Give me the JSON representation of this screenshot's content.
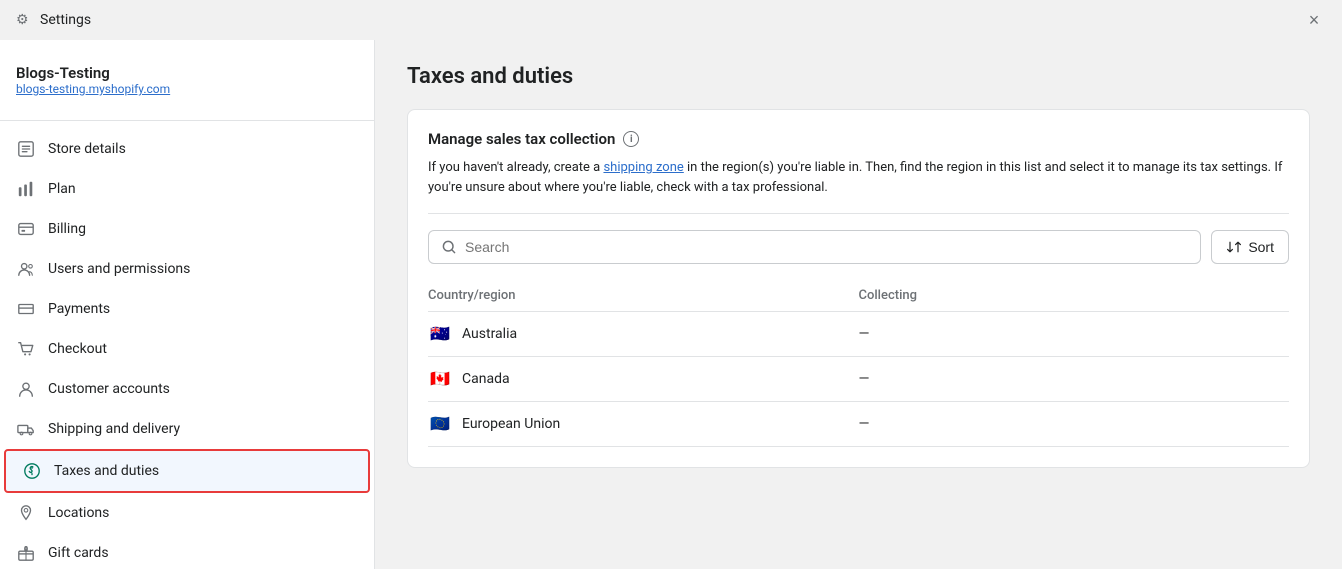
{
  "titleBar": {
    "icon": "⚙",
    "title": "Settings",
    "closeLabel": "×"
  },
  "sidebar": {
    "storeName": "Blogs-Testing",
    "storeUrl": "blogs-testing.myshopify.com",
    "items": [
      {
        "id": "store-details",
        "label": "Store details",
        "icon": "🏪"
      },
      {
        "id": "plan",
        "label": "Plan",
        "icon": "📊"
      },
      {
        "id": "billing",
        "label": "Billing",
        "icon": "🧾"
      },
      {
        "id": "users-permissions",
        "label": "Users and permissions",
        "icon": "👥"
      },
      {
        "id": "payments",
        "label": "Payments",
        "icon": "💳"
      },
      {
        "id": "checkout",
        "label": "Checkout",
        "icon": "🛒"
      },
      {
        "id": "customer-accounts",
        "label": "Customer accounts",
        "icon": "👤"
      },
      {
        "id": "shipping-delivery",
        "label": "Shipping and delivery",
        "icon": "🚚"
      },
      {
        "id": "taxes-duties",
        "label": "Taxes and duties",
        "icon": "🏷",
        "active": true
      },
      {
        "id": "locations",
        "label": "Locations",
        "icon": "📍"
      },
      {
        "id": "gift-cards",
        "label": "Gift cards",
        "icon": "🎁"
      }
    ]
  },
  "main": {
    "pageTitle": "Taxes and duties",
    "card": {
      "sectionTitle": "Manage sales tax collection",
      "description1": "If you haven't already, create a ",
      "linkText": "shipping zone",
      "description2": " in the region(s) you're liable in. Then, find the region in this list and select it to manage its tax settings. If you're unsure about where you're liable, check with a tax professional.",
      "searchPlaceholder": "Search",
      "sortLabel": "Sort",
      "tableHeaders": {
        "country": "Country/region",
        "collecting": "Collecting"
      },
      "rows": [
        {
          "country": "Australia",
          "flag": "🇦🇺",
          "collecting": "—"
        },
        {
          "country": "Canada",
          "flag": "🇨🇦",
          "collecting": "—"
        },
        {
          "country": "European Union",
          "flag": "🇪🇺",
          "collecting": "—"
        }
      ]
    }
  }
}
